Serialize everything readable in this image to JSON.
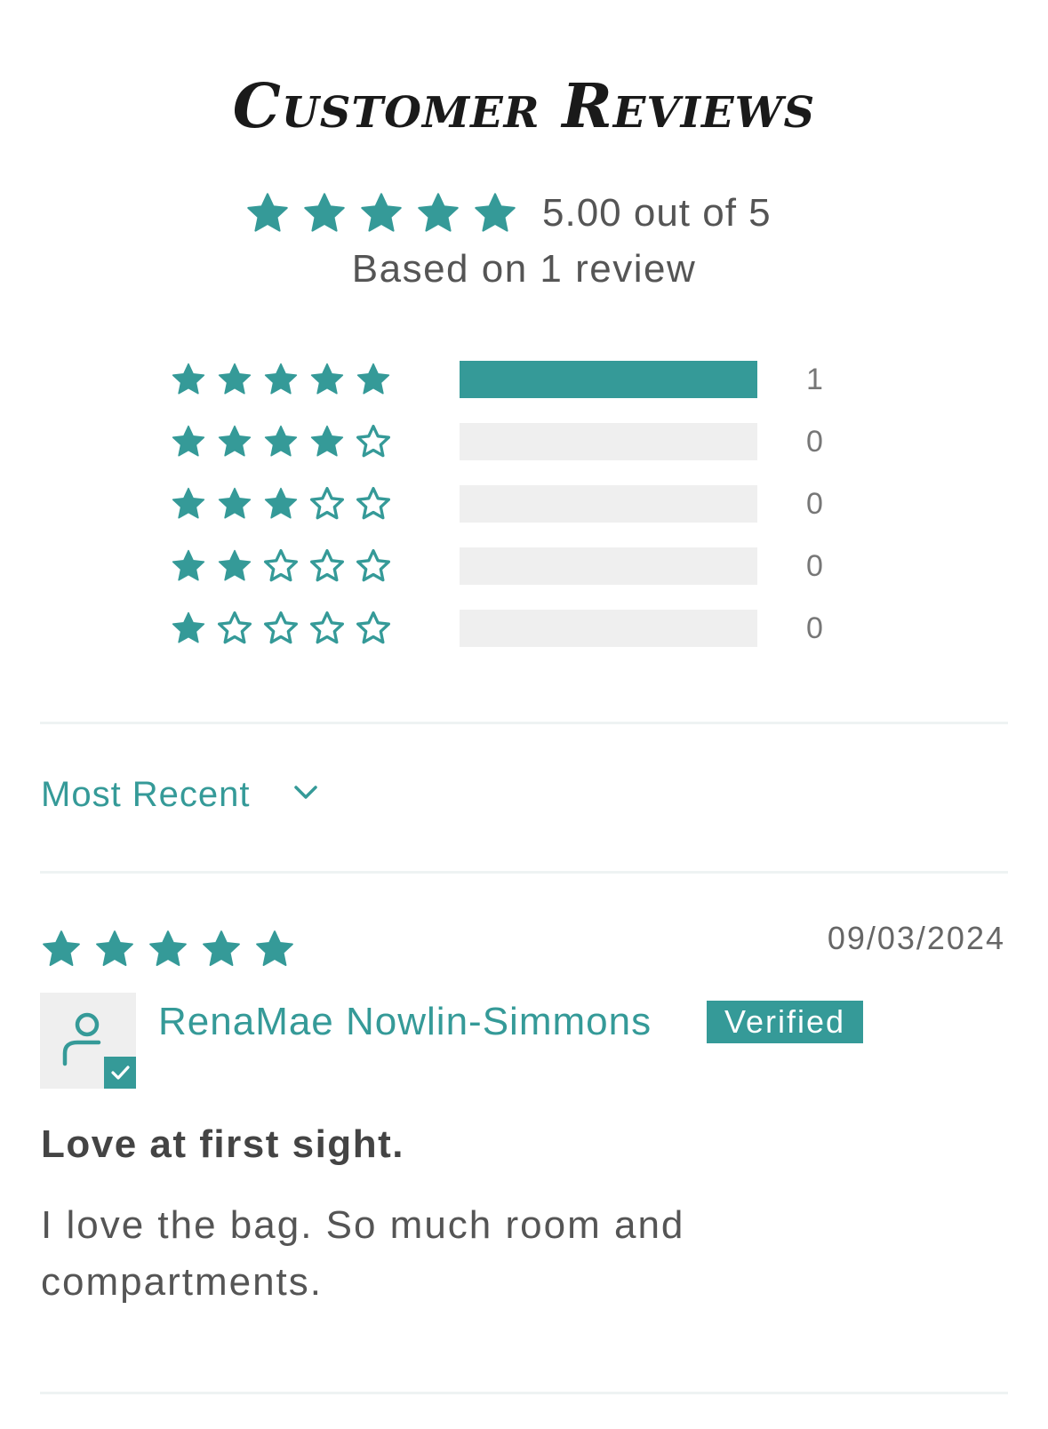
{
  "header": {
    "title": "Customer Reviews"
  },
  "summary": {
    "average_text": "5.00 out of 5",
    "average": 5.0,
    "based_on": "Based on 1 review"
  },
  "histogram": [
    {
      "stars": 5,
      "count": "1",
      "fraction": 1.0
    },
    {
      "stars": 4,
      "count": "0",
      "fraction": 0
    },
    {
      "stars": 3,
      "count": "0",
      "fraction": 0
    },
    {
      "stars": 2,
      "count": "0",
      "fraction": 0
    },
    {
      "stars": 1,
      "count": "0",
      "fraction": 0
    }
  ],
  "sort": {
    "selected": "Most Recent"
  },
  "reviews": [
    {
      "rating": 5,
      "date": "09/03/2024",
      "author": "RenaMae Nowlin-Simmons",
      "badge": "Verified",
      "title": "Love at first sight.",
      "body": "I love the bag. So much room and compartments."
    }
  ],
  "colors": {
    "accent": "#359a98",
    "bar_empty": "#efefef",
    "text": "#555555"
  },
  "icons": {
    "star_filled": "star-filled-icon",
    "star_empty": "star-outline-icon",
    "chevron": "chevron-down-icon",
    "user": "user-icon",
    "check": "check-icon"
  }
}
